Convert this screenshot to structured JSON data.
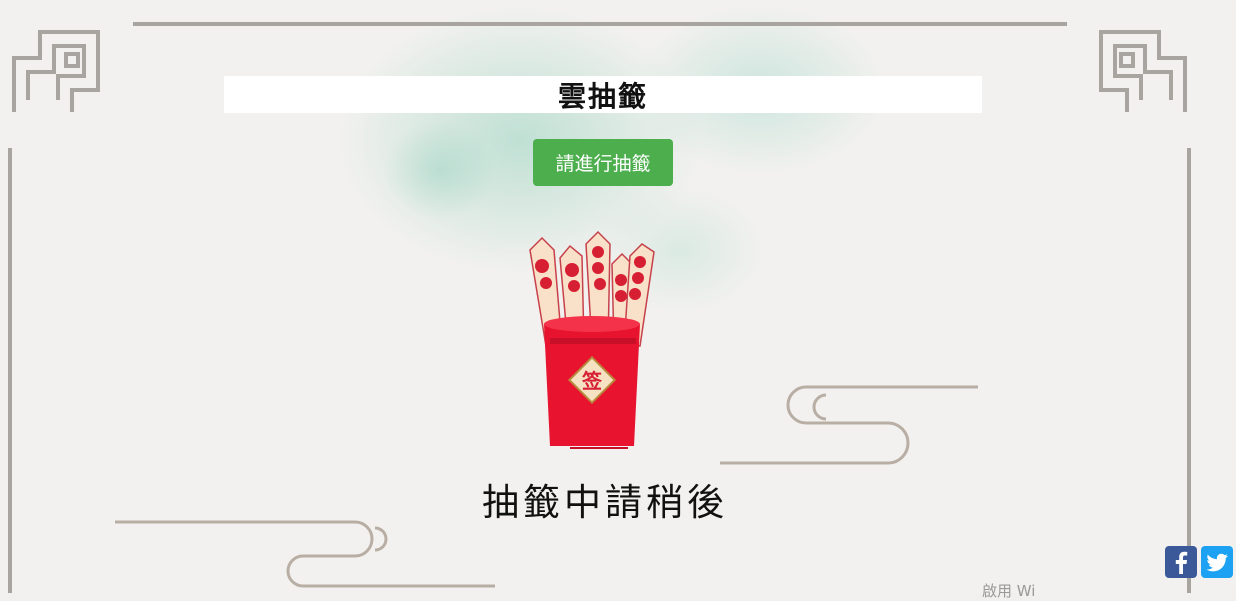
{
  "header": {
    "title": "雲抽籤"
  },
  "actions": {
    "draw_label": "請進行抽籤"
  },
  "status": {
    "text": "抽籤中請稍後"
  },
  "image": {
    "cup_label": "签"
  },
  "share": {
    "facebook_icon": "facebook-icon",
    "twitter_icon": "twitter-icon"
  },
  "footer": {
    "text": "啟用 Wi"
  },
  "colors": {
    "button": "#4cae4c",
    "cup_red": "#e8132f",
    "facebook": "#3b5998",
    "twitter": "#1da1f2"
  }
}
